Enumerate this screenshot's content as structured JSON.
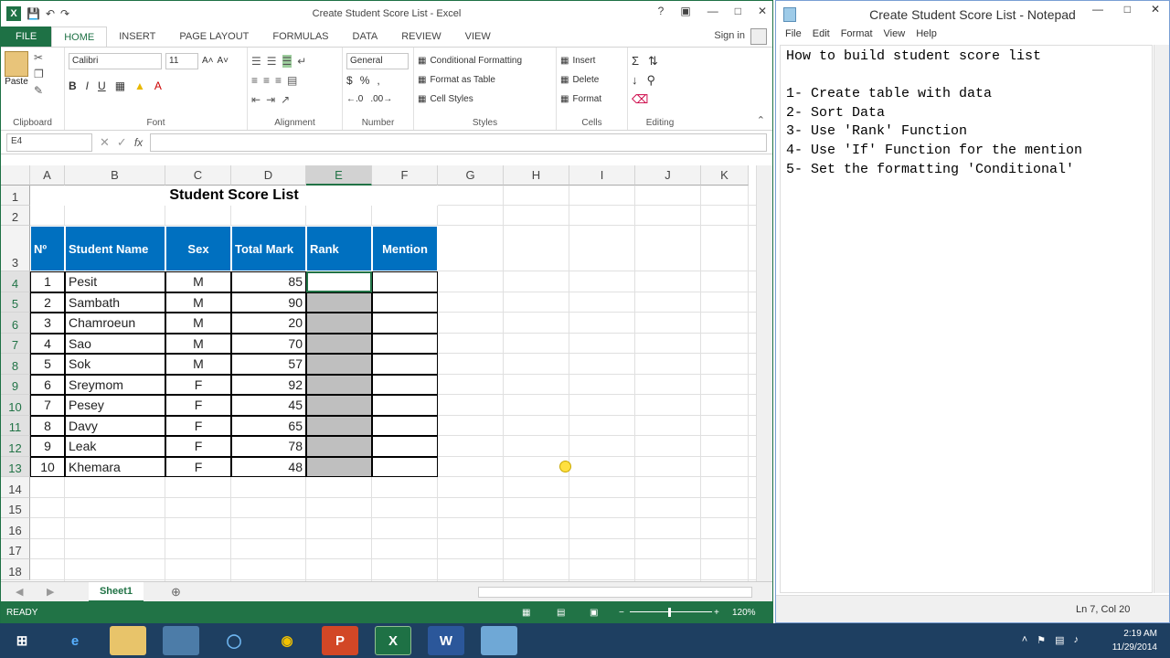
{
  "excel": {
    "window_title": "Create Student Score List - Excel",
    "help": "?",
    "tabs": [
      "FILE",
      "HOME",
      "INSERT",
      "PAGE LAYOUT",
      "FORMULAS",
      "DATA",
      "REVIEW",
      "VIEW"
    ],
    "sign_in": "Sign in",
    "ribbon": {
      "paste": "Paste",
      "font_name": "Calibri",
      "font_size": "11",
      "number_format": "General",
      "conditional_formatting": "Conditional Formatting",
      "format_as_table": "Format as Table",
      "cell_styles": "Cell Styles",
      "insert": "Insert",
      "delete": "Delete",
      "format": "Format",
      "groups": [
        "Clipboard",
        "Font",
        "Alignment",
        "Number",
        "Styles",
        "Cells",
        "Editing"
      ]
    },
    "name_box": "E4",
    "fx": "fx",
    "columns": [
      "A",
      "B",
      "C",
      "D",
      "E",
      "F",
      "G",
      "H",
      "I",
      "J",
      "K"
    ],
    "rows": [
      "1",
      "2",
      "3",
      "4",
      "5",
      "6",
      "7",
      "8",
      "9",
      "10",
      "11",
      "12",
      "13",
      "14",
      "15",
      "16",
      "17",
      "18"
    ],
    "sheet_title": "Student Score List",
    "table_headers": [
      "Nº",
      "Student Name",
      "Sex",
      "Total Mark",
      "Rank",
      "Mention"
    ],
    "table_rows": [
      [
        "1",
        "Pesit",
        "M",
        "85"
      ],
      [
        "2",
        "Sambath",
        "M",
        "90"
      ],
      [
        "3",
        "Chamroeun",
        "M",
        "20"
      ],
      [
        "4",
        "Sao",
        "M",
        "70"
      ],
      [
        "5",
        "Sok",
        "M",
        "57"
      ],
      [
        "6",
        "Sreymom",
        "F",
        "92"
      ],
      [
        "7",
        "Pesey",
        "F",
        "45"
      ],
      [
        "8",
        "Davy",
        "F",
        "65"
      ],
      [
        "9",
        "Leak",
        "F",
        "78"
      ],
      [
        "10",
        "Khemara",
        "F",
        "48"
      ]
    ],
    "sheet_tab": "Sheet1",
    "status": "READY",
    "zoom": "120%"
  },
  "notepad": {
    "window_title": "Create Student Score List - Notepad",
    "menu": [
      "File",
      "Edit",
      "Format",
      "View",
      "Help"
    ],
    "text": "How to build student score list\n\n1- Create table with data\n2- Sort Data\n3- Use 'Rank' Function\n4- Use 'If' Function for the mention\n5- Set the formatting 'Conditional'",
    "status": "Ln 7, Col 20"
  },
  "taskbar": {
    "time": "2:19 AM",
    "date": "11/29/2014"
  }
}
